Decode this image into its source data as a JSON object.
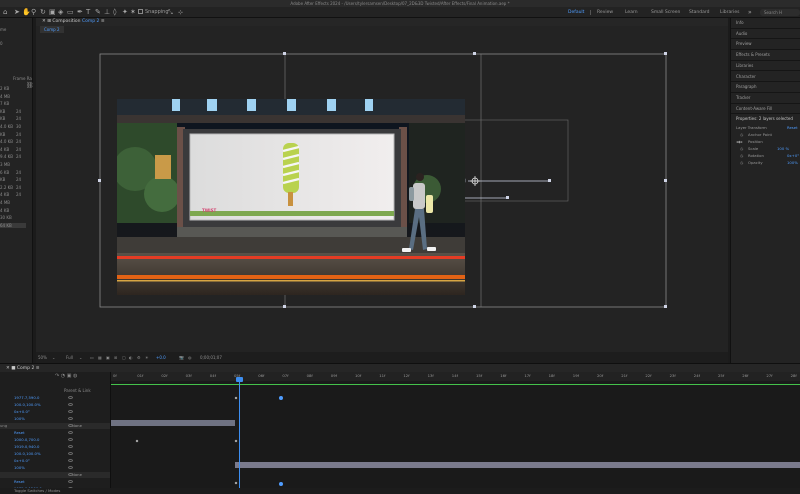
{
  "app": {
    "title": "Adobe After Effects 2024 - /Users/tylersamsen/Desktop/07_2D&3D Twisted/After Effects/Final Animation.aep *"
  },
  "toolbar": {
    "snapping_label": "Snapping",
    "workspaces": [
      {
        "label": "Default",
        "active": true
      },
      {
        "label": "Review",
        "active": false
      },
      {
        "label": "Learn",
        "active": false
      },
      {
        "label": "Small Screen",
        "active": false
      },
      {
        "label": "Standard",
        "active": false
      },
      {
        "label": "Libraries",
        "active": false
      }
    ],
    "search_placeholder": "Search H"
  },
  "project_panel": {
    "labels": [
      "me",
      "0"
    ],
    "column_header": "Frame Ra",
    "rows": [
      {
        "size": "2 KB",
        "fps": ""
      },
      {
        "size": "4 MB",
        "fps": ""
      },
      {
        "size": "7 KB",
        "fps": ""
      },
      {
        "size": "KB",
        "fps": "24"
      },
      {
        "size": "KB",
        "fps": "24"
      },
      {
        "size": "4.0 KB",
        "fps": "30"
      },
      {
        "size": "KB",
        "fps": "24"
      },
      {
        "size": "4.0 KB",
        "fps": "24"
      },
      {
        "size": "4 KB",
        "fps": "24"
      },
      {
        "size": "9.4 KB",
        "fps": "24"
      },
      {
        "size": "3 MB",
        "fps": ""
      },
      {
        "size": "6 KB",
        "fps": "24"
      },
      {
        "size": "KB",
        "fps": "24"
      },
      {
        "size": "2.2 KB",
        "fps": "24"
      },
      {
        "size": "4 KB",
        "fps": "24"
      },
      {
        "size": "4 MB",
        "fps": ""
      },
      {
        "size": "4 KB",
        "fps": ""
      },
      {
        "size": "30 KB",
        "fps": ""
      },
      {
        "size": "64 KB",
        "fps": ""
      }
    ]
  },
  "composition": {
    "tab_prefix": "Composition",
    "tab_name": "Comp 2",
    "subtab": "Comp 2",
    "billboard_text": "TWIST"
  },
  "viewer_bar": {
    "zoom": "50%",
    "resolution": "Full",
    "exposure": "+0.0",
    "timecode": "0;00;01;07"
  },
  "right_panel": {
    "items": [
      "Info",
      "Audio",
      "Preview",
      "Effects & Presets",
      "Libraries",
      "Character",
      "Paragraph",
      "Tracker",
      "Content-Aware Fill"
    ],
    "properties_title": "Properties: 2 layers selected",
    "layer_transform": "Layer Transform",
    "reset": "Reset",
    "props": [
      {
        "name": "Anchor Point",
        "value": ""
      },
      {
        "name": "Position",
        "value": ""
      },
      {
        "name": "Scale",
        "value": "100 %"
      },
      {
        "name": "Rotation",
        "value": "0x+0°"
      },
      {
        "name": "Opacity",
        "value": "100%"
      }
    ]
  },
  "timeline": {
    "tab": "Comp 2",
    "header": "Parent & Link",
    "ruler": [
      "0f",
      "01f",
      "02f",
      "03f",
      "04f",
      "05f",
      "06f",
      "07f",
      "08f",
      "09f",
      "10f",
      "11f",
      "12f",
      "13f",
      "14f",
      "15f",
      "16f",
      "17f",
      "18f",
      "19f",
      "20f",
      "21f",
      "22f",
      "23f",
      "24f",
      "25f",
      "26f",
      "27f",
      "28f"
    ],
    "rows": [
      {
        "kind": "prop",
        "text": "1977.7,590.0"
      },
      {
        "kind": "prop",
        "text": "100.0,100.0%"
      },
      {
        "kind": "prop",
        "text": "0x+0.0°"
      },
      {
        "kind": "prop",
        "text": "100%"
      },
      {
        "kind": "layer",
        "text": "ung",
        "mode": "None"
      },
      {
        "kind": "reset",
        "text": "Reset"
      },
      {
        "kind": "prop",
        "text": "1000.0,700.0"
      },
      {
        "kind": "prop",
        "text": "1919.0,940.0"
      },
      {
        "kind": "prop",
        "text": "100.0,100.0%"
      },
      {
        "kind": "prop",
        "text": "0x+0.0°"
      },
      {
        "kind": "prop",
        "text": "100%"
      },
      {
        "kind": "layer",
        "text": "",
        "mode": "None"
      },
      {
        "kind": "reset",
        "text": "Reset"
      },
      {
        "kind": "prop",
        "text": "1085.0,1206.0"
      },
      {
        "kind": "prop",
        "text": "1748.7,1456.0"
      }
    ],
    "footer": "Toggle Switches / Modes"
  },
  "colors": {
    "accent": "#4f9dff",
    "panel": "#232323",
    "layer_bar": "#7a7a8c"
  }
}
